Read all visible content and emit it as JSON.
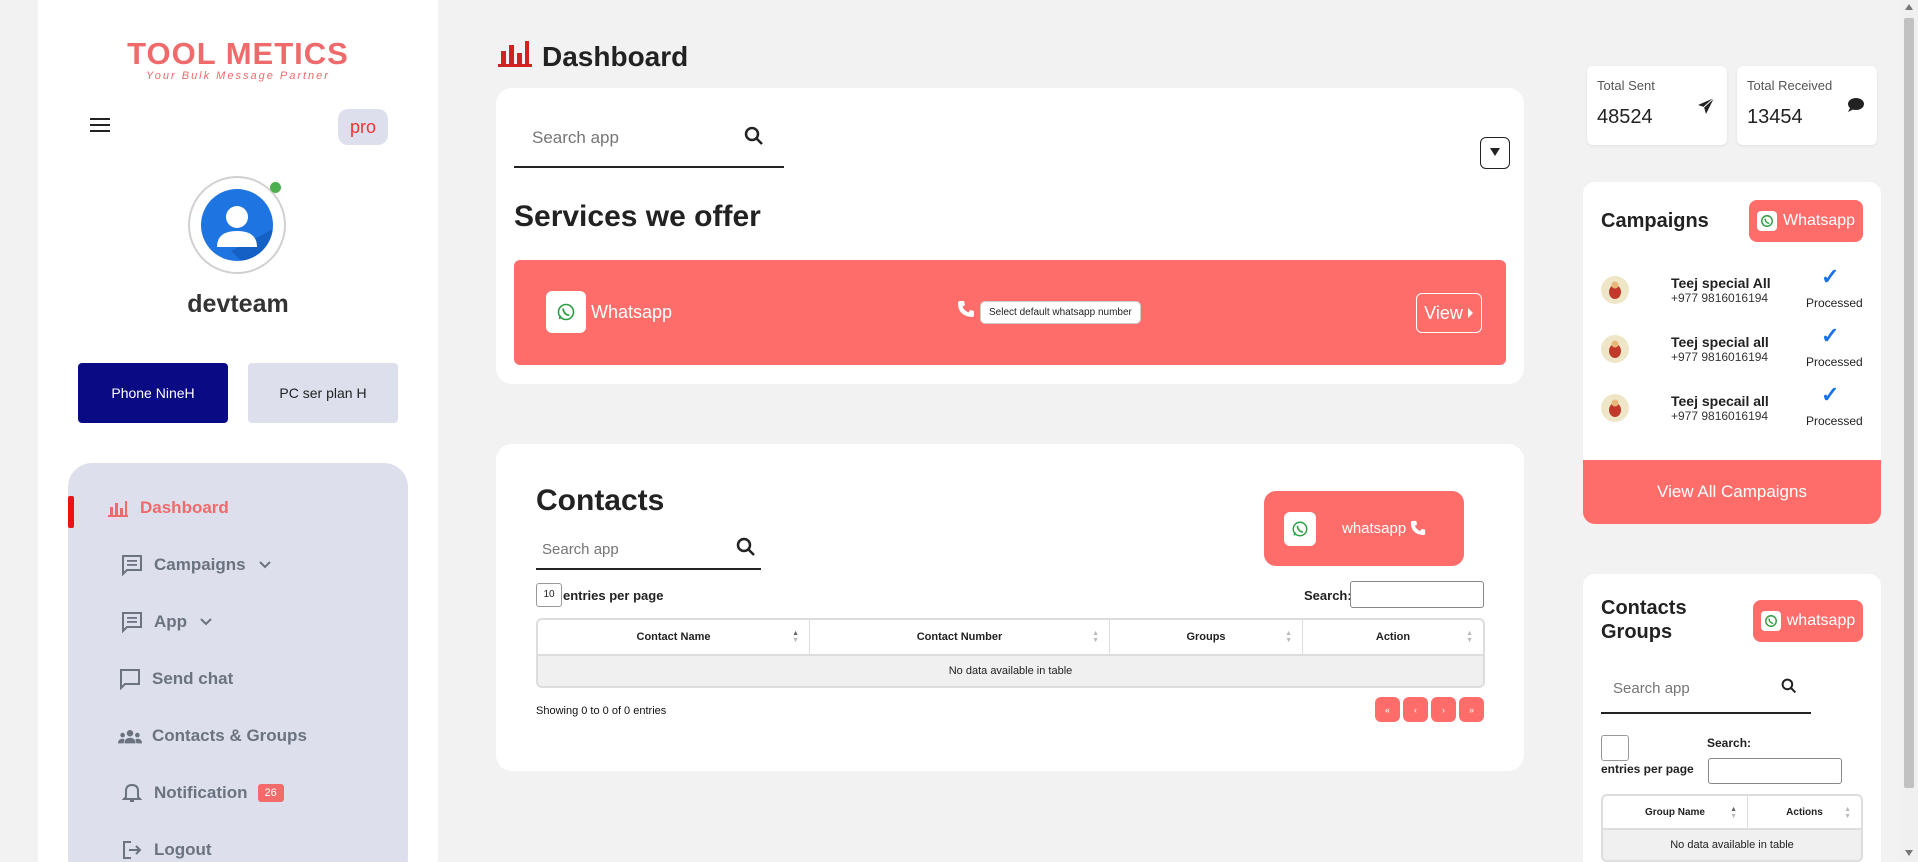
{
  "brand": {
    "name": "TOOL METICS",
    "tagline": "Your Bulk Message Partner"
  },
  "header": {
    "pro_label": "pro",
    "username": "devteam"
  },
  "plans": [
    {
      "label": "Phone NineH"
    },
    {
      "label": "PC ser plan H"
    }
  ],
  "sidebar": {
    "items": [
      {
        "label": "Dashboard"
      },
      {
        "label": "Campaigns"
      },
      {
        "label": "App"
      },
      {
        "label": "Send chat"
      },
      {
        "label": "Contacts & Groups"
      },
      {
        "label": "Notification",
        "badge": "26"
      },
      {
        "label": "Logout"
      }
    ]
  },
  "page": {
    "title": "Dashboard"
  },
  "services": {
    "search_placeholder": "Search app",
    "heading": "Services we offer",
    "banner_label": "Whatsapp",
    "default_number_text": "Select default whatsapp number",
    "view_label": "View"
  },
  "contacts": {
    "heading": "Contacts",
    "search_placeholder": "Search app",
    "whatsapp_button": "whatsapp",
    "entries_value": "10",
    "entries_label": "entries per page",
    "search_label": "Search:",
    "columns": [
      "Contact Name",
      "Contact Number",
      "Groups",
      "Action"
    ],
    "empty_text": "No data available in table",
    "showing": "Showing 0 to 0 of 0 entries",
    "pager": [
      "«",
      "‹",
      "›",
      "»"
    ]
  },
  "stats": [
    {
      "label": "Total Sent",
      "value": "48524",
      "icon": "send-icon"
    },
    {
      "label": "Total Received",
      "value": "13454",
      "icon": "chat-bubble-icon"
    }
  ],
  "campaigns": {
    "title": "Campaigns",
    "button": "Whatsapp",
    "items": [
      {
        "name": "Teej special All",
        "phone": "+977 9816016194",
        "status": "Processed"
      },
      {
        "name": "Teej special all",
        "phone": "+977 9816016194",
        "status": "Processed"
      },
      {
        "name": "Teej specail all",
        "phone": "+977 9816016194",
        "status": "Processed"
      }
    ],
    "view_all": "View All Campaigns"
  },
  "groups": {
    "title_line1": "Contacts",
    "title_line2": "Groups",
    "button": "whatsapp",
    "search_placeholder": "Search app",
    "entries_label": "entries per page",
    "search_label": "Search:",
    "columns": [
      "Group Name",
      "Actions"
    ],
    "empty_text": "No data available in table"
  },
  "colors": {
    "accent": "#ff6d6b",
    "brand_red": "#ef6a6a",
    "plan_primary": "#0a0a85",
    "menu_bg": "#dde0ec"
  }
}
